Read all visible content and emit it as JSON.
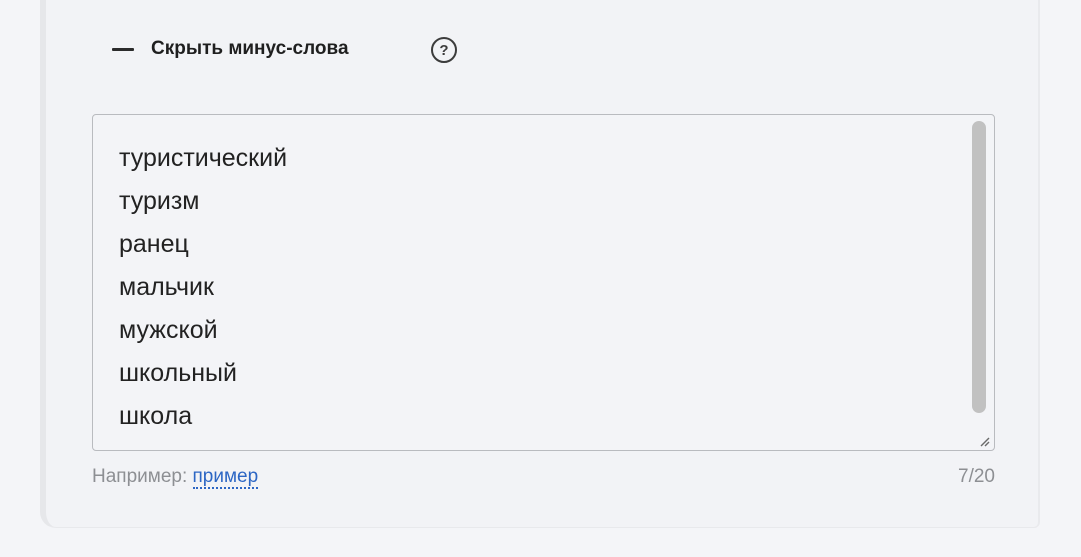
{
  "section": {
    "toggle_label": "Скрыть минус-слова",
    "help_symbol": "?"
  },
  "textarea": {
    "words": [
      "туристический",
      "туризм",
      "ранец",
      "мальчик",
      "мужской",
      "школьный",
      "школа"
    ]
  },
  "hint": {
    "prefix": "Например:",
    "link_label": "пример"
  },
  "counter": "7/20",
  "colors": {
    "link": "#2c66c4",
    "muted_text": "#8d8f93",
    "border": "#b9bbbf"
  },
  "icons": {
    "toggle": "minus-icon",
    "help": "question-circle-icon",
    "resize": "resize-grip-icon"
  }
}
